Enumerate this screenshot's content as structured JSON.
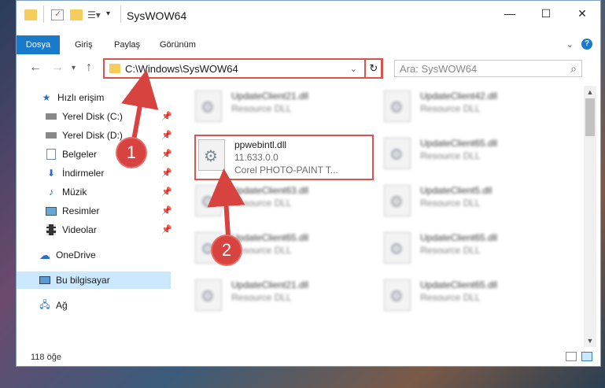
{
  "window": {
    "title": "SysWOW64"
  },
  "ribbon": {
    "tabs": [
      "Dosya",
      "Giriş",
      "Paylaş",
      "Görünüm"
    ]
  },
  "address": {
    "path": "C:\\Windows\\SysWOW64"
  },
  "search": {
    "placeholder": "Ara: SysWOW64"
  },
  "sidebar": {
    "items": [
      {
        "label": "Hızlı erişim",
        "icon": "star-icon"
      },
      {
        "label": "Yerel Disk (C:)",
        "icon": "drive-icon"
      },
      {
        "label": "Yerel Disk (D:)",
        "icon": "drive-icon"
      },
      {
        "label": "Belgeler",
        "icon": "documents-icon"
      },
      {
        "label": "İndirmeler",
        "icon": "download-icon"
      },
      {
        "label": "Müzik",
        "icon": "music-icon"
      },
      {
        "label": "Resimler",
        "icon": "pictures-icon"
      },
      {
        "label": "Videolar",
        "icon": "videos-icon"
      },
      {
        "label": "OneDrive",
        "icon": "cloud-icon"
      },
      {
        "label": "Bu bilgisayar",
        "icon": "computer-icon"
      },
      {
        "label": "Ağ",
        "icon": "network-icon"
      }
    ]
  },
  "files": [
    {
      "name": "UpdateClient21.dll",
      "type": "Resource DLL"
    },
    {
      "name": "UpdateClient42.dll",
      "type": "Resource DLL"
    },
    {
      "name": "ppwebintl.dll",
      "version": "11.633.0.0",
      "desc": "Corel PHOTO-PAINT T..."
    },
    {
      "name": "UpdateClient65.dll",
      "type": "Resource DLL"
    },
    {
      "name": "UpdateClient63.dll",
      "type": "Resource DLL"
    },
    {
      "name": "UpdateClient5.dll",
      "type": "Resource DLL"
    },
    {
      "name": "UpdateClient65.dll",
      "type": "Resource DLL"
    },
    {
      "name": "UpdateClient65.dll",
      "type": "Resource DLL"
    },
    {
      "name": "UpdateClient21.dll",
      "type": "Resource DLL"
    },
    {
      "name": "UpdateClient65.dll",
      "type": "Resource DLL"
    }
  ],
  "status": {
    "count": "118 öğe"
  },
  "callouts": [
    "1",
    "2"
  ],
  "colors": {
    "accent": "#1979ca",
    "highlight": "#d9534f"
  }
}
